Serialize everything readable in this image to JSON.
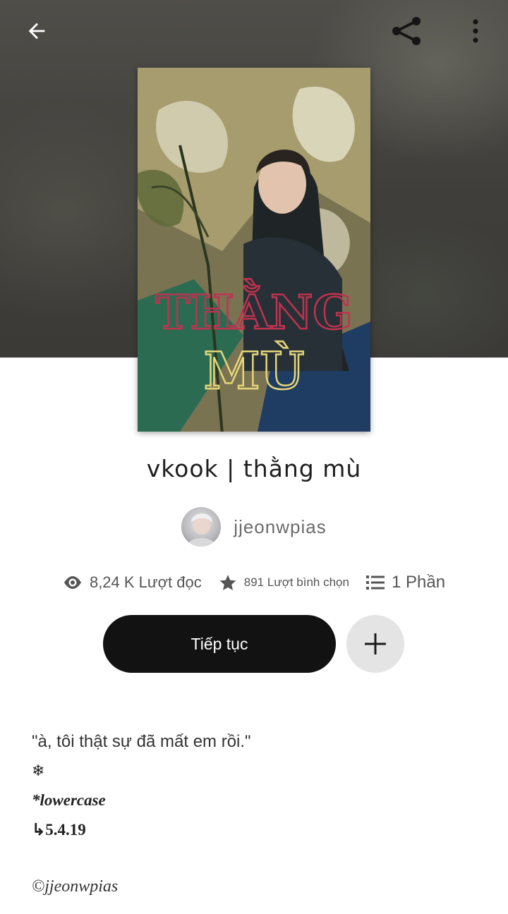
{
  "header": {
    "back_icon": "arrow-left-icon",
    "share_icon": "share-icon",
    "more_icon": "more-vertical-icon"
  },
  "story": {
    "cover_text_line1": "THẰNG",
    "cover_text_line2": "MÙ",
    "title": "vkook | thằng mù",
    "author": "jjeonwpias"
  },
  "stats": {
    "reads": "8,24 K Lượt đọc",
    "votes": "891 Lượt bình chọn",
    "parts": "1 Phần"
  },
  "actions": {
    "continue_label": "Tiếp tục",
    "add_icon": "plus-icon"
  },
  "description": {
    "line1": "\"à, tôi thật sự đã mất em rồi.\"",
    "line2": "❄",
    "line3": "*lowercase",
    "line4": "↳5.4.19",
    "copyright": "©jjeonwpias"
  },
  "colors": {
    "button_dark": "#121212",
    "button_light": "#e4e4e4",
    "hero_bg": "#45443f"
  }
}
